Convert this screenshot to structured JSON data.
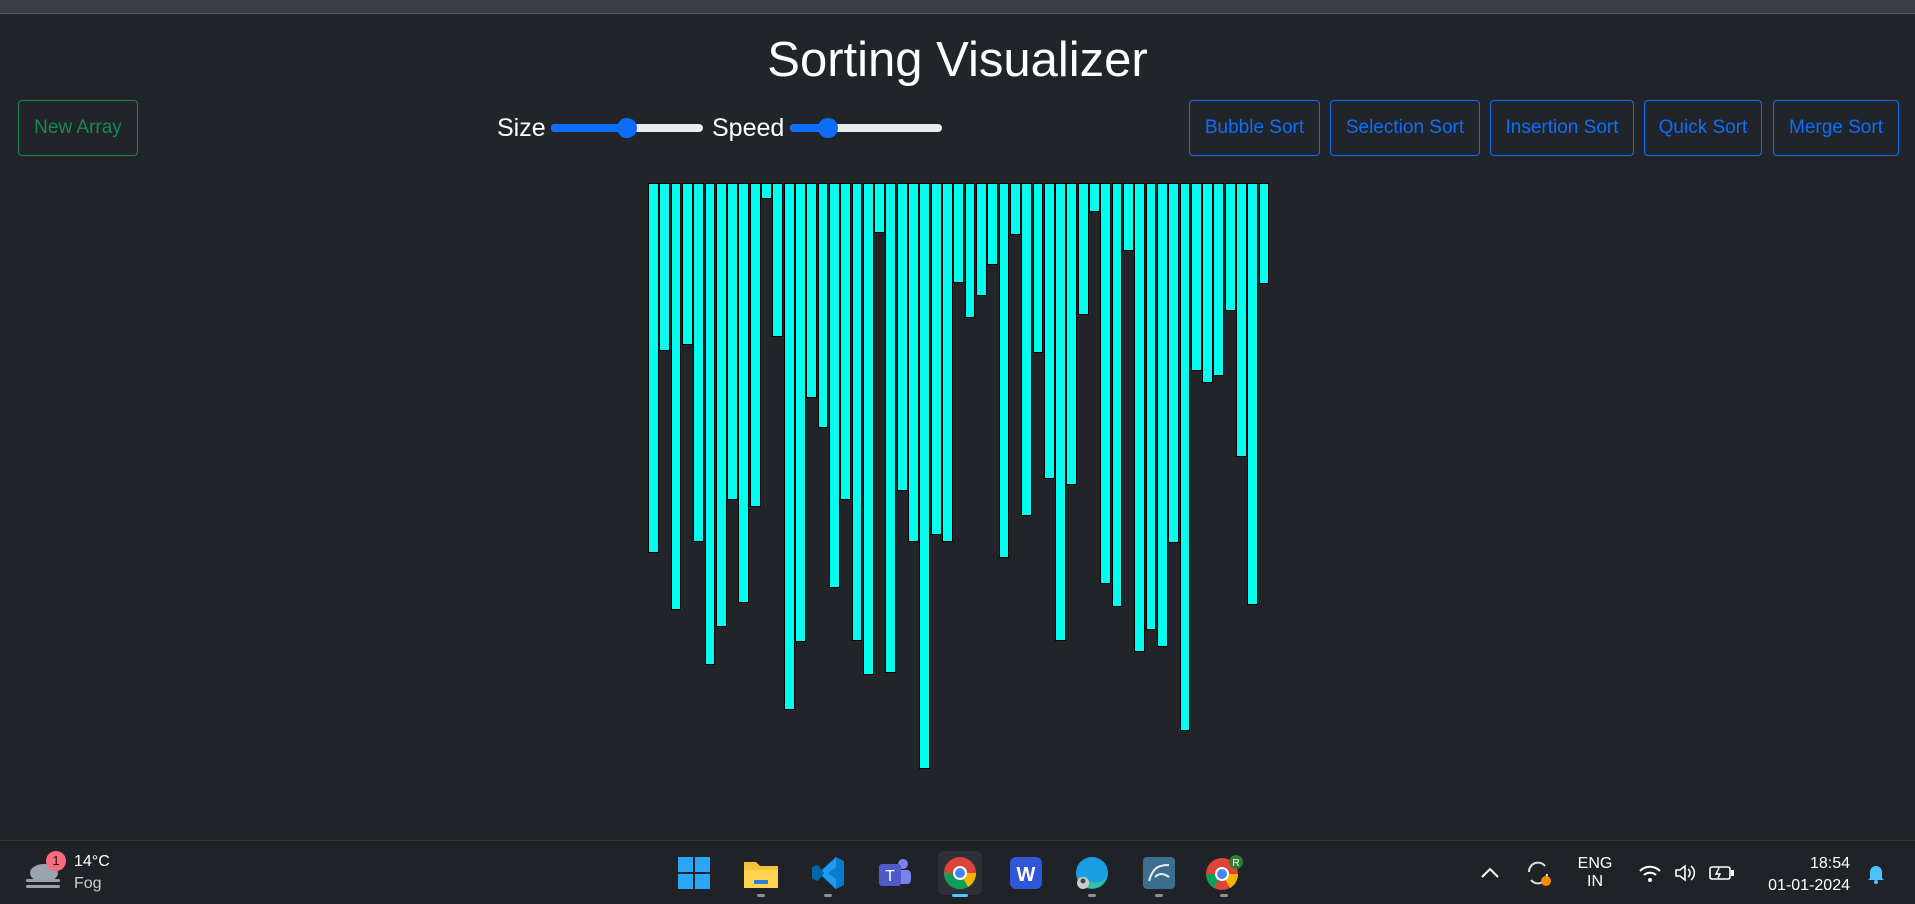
{
  "title": "Sorting Visualizer",
  "controls": {
    "new_array": "New Array",
    "size_label": "Size",
    "speed_label": "Speed",
    "size_value": 0.5,
    "speed_value": 0.25
  },
  "algorithms": [
    "Bubble Sort",
    "Selection Sort",
    "Insertion Sort",
    "Quick Sort",
    "Merge Sort"
  ],
  "bars": [
    370,
    168,
    427,
    162,
    359,
    482,
    444,
    317,
    420,
    324,
    16,
    154,
    527,
    459,
    215,
    245,
    405,
    317,
    458,
    492,
    50,
    490,
    308,
    359,
    586,
    352,
    359,
    100,
    135,
    113,
    82,
    375,
    52,
    333,
    170,
    296,
    458,
    302,
    132,
    29,
    401,
    424,
    68,
    469,
    447,
    464,
    360,
    548,
    188,
    200,
    193,
    128,
    274,
    422,
    101
  ],
  "colors": {
    "background": "#212529",
    "bar": "#00ffee",
    "primary": "#0d6efd",
    "success": "#198754"
  },
  "taskbar": {
    "weather_temp": "14°C",
    "weather_cond": "Fog",
    "weather_badge": "1",
    "lang_line1": "ENG",
    "lang_line2": "IN",
    "time": "18:54",
    "date": "01-01-2024",
    "apps": [
      "start-icon",
      "file-explorer-icon",
      "vscode-icon",
      "teams-icon",
      "chrome-icon",
      "wps-office-icon",
      "edge-icon",
      "mysql-workbench-icon",
      "chrome-profile-icon"
    ]
  }
}
